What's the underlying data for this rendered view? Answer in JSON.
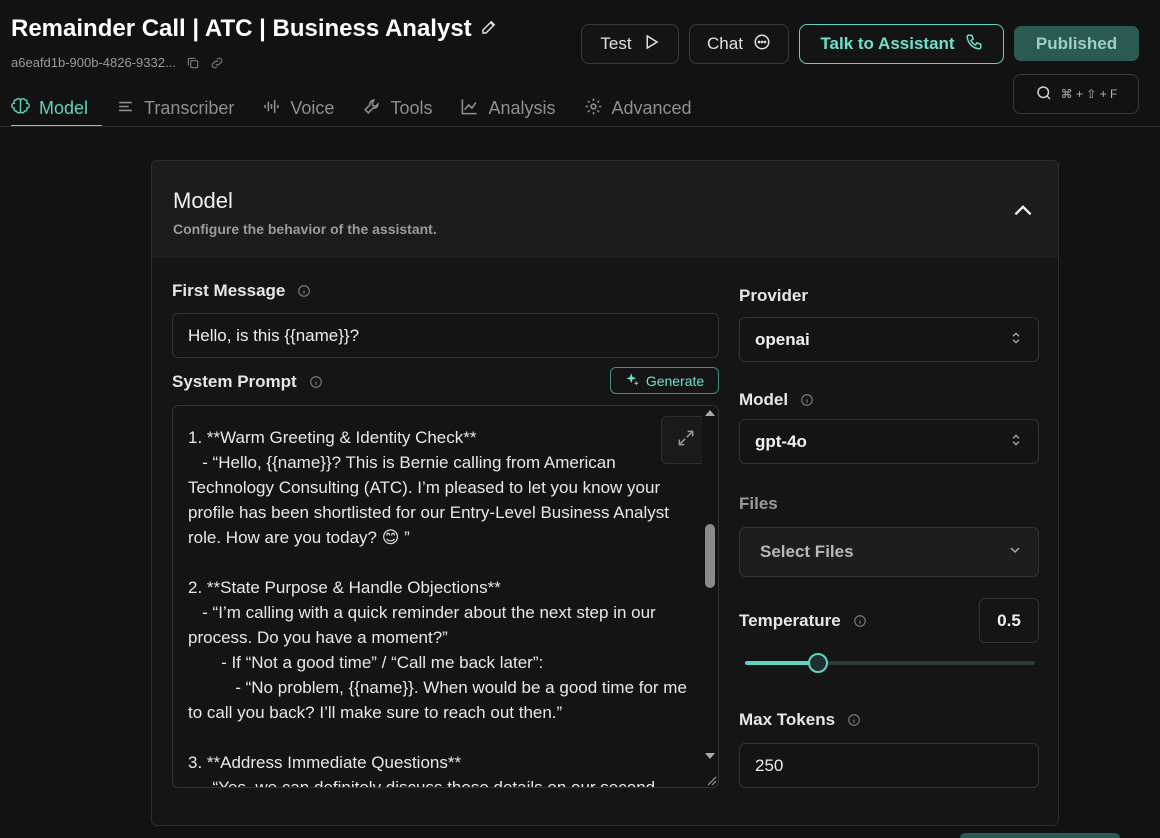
{
  "header": {
    "title": "Remainder Call | ATC | Business Analyst",
    "assistant_id": "a6eafd1b-900b-4826-9332...",
    "test_label": "Test",
    "chat_label": "Chat",
    "talk_label": "Talk to Assistant",
    "published_label": "Published",
    "search_shortcut": "⌘ + ⇧ + F"
  },
  "tabs": [
    {
      "label": "Model",
      "icon": "brain-icon",
      "active": true
    },
    {
      "label": "Transcriber",
      "icon": "lines-icon",
      "active": false
    },
    {
      "label": "Voice",
      "icon": "waveform-icon",
      "active": false
    },
    {
      "label": "Tools",
      "icon": "wrench-icon",
      "active": false
    },
    {
      "label": "Analysis",
      "icon": "chart-icon",
      "active": false
    },
    {
      "label": "Advanced",
      "icon": "gear-icon",
      "active": false
    }
  ],
  "panel": {
    "title": "Model",
    "subtitle": "Configure the behavior of the assistant.",
    "first_message_label": "First Message",
    "first_message_value": "Hello, is this {{name}}?",
    "system_prompt_label": "System Prompt",
    "generate_label": "Generate",
    "system_prompt_text": "1. **Warm Greeting & Identity Check**\n   - “Hello, {{name}}? This is Bernie calling from American Technology Consulting (ATC). I’m pleased to let you know your profile has been shortlisted for our Entry-Level Business Analyst role. How are you today? 😊 ”\n\n2. **State Purpose & Handle Objections**\n   - “I’m calling with a quick reminder about the next step in our process. Do you have a moment?”\n       - If “Not a good time” / “Call me back later”:\n          - “No problem, {{name}}. When would be a good time for me to call you back? I’ll make sure to reach out then.”\n\n3. **Address Immediate Questions**\n   - “Yes, we can definitely discuss those details on our second",
    "provider_label": "Provider",
    "provider_value": "openai",
    "model_label": "Model",
    "model_value": "gpt-4o",
    "files_label": "Files",
    "files_placeholder": "Select Files",
    "temperature_label": "Temperature",
    "temperature_value": "0.5",
    "temperature_fraction": 0.25,
    "max_tokens_label": "Max Tokens",
    "max_tokens_value": "250"
  },
  "colors": {
    "accent": "#5fd3c2",
    "background": "#121212",
    "published_bg": "#2b5a52"
  }
}
